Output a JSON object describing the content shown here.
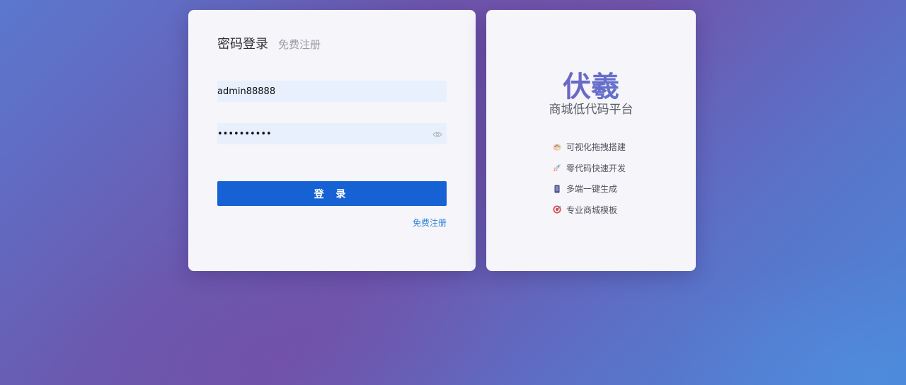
{
  "login": {
    "tab_active": "密码登录",
    "tab_inactive": "免费注册",
    "username_value": "admin88888",
    "password_value": "••••••••••",
    "login_button": "登 录",
    "register_link": "免费注册"
  },
  "brand": {
    "title": "伏羲",
    "subtitle": "商城低代码平台",
    "features": [
      {
        "icon": "palette-icon",
        "label": "可视化拖拽搭建"
      },
      {
        "icon": "rocket-icon",
        "label": "零代码快速开发"
      },
      {
        "icon": "phone-icon",
        "label": "多端一键生成"
      },
      {
        "icon": "target-icon",
        "label": "专业商城模板"
      }
    ]
  },
  "colors": {
    "primary": "#1662d4",
    "link": "#2f7fd8",
    "input_bg": "#e8f0fe",
    "card_bg": "#f5f5fa"
  }
}
